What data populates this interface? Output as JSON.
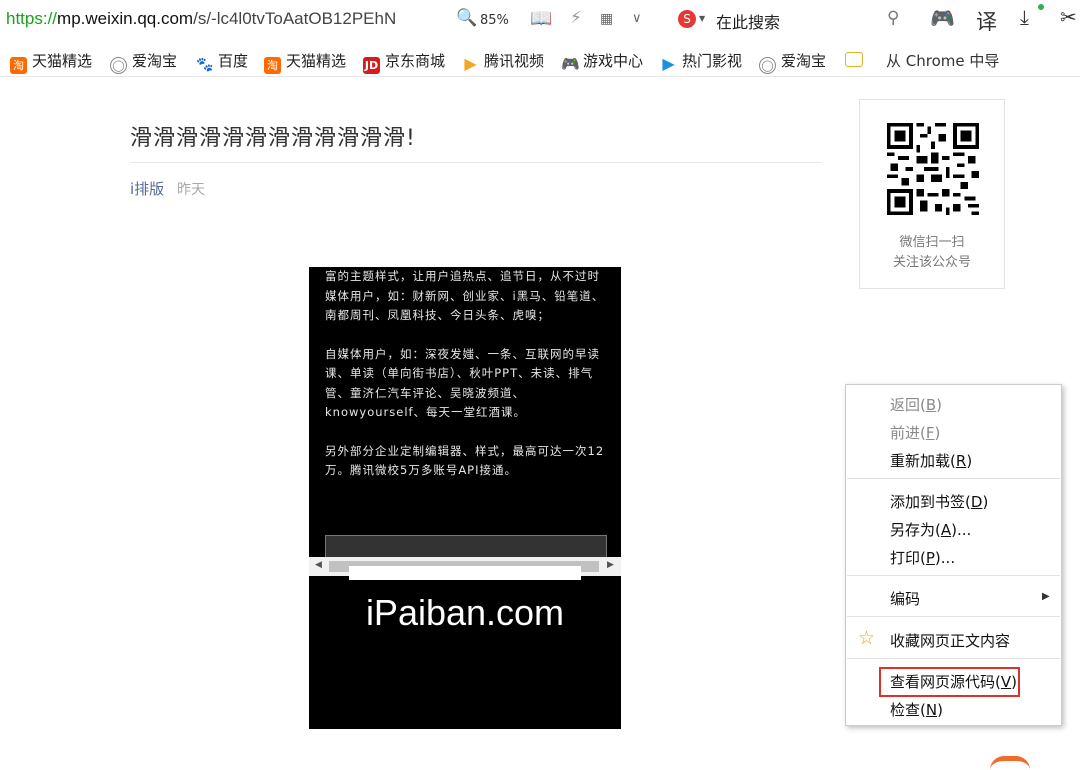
{
  "browser": {
    "url_scheme": "https://",
    "url_host": "mp.weixin.qq.com",
    "url_path": "/s/-lc4l0tvToAatOB12PEhN",
    "zoom": "85%",
    "search_placeholder": "在此搜索",
    "translate_label": "译"
  },
  "bookmarks": [
    {
      "label": "天猫精选",
      "icon": "tmall-icon",
      "color": "#ff6a00"
    },
    {
      "label": "爱淘宝",
      "icon": "globe-icon",
      "color": "#888888"
    },
    {
      "label": "百度",
      "icon": "baidu-paw-icon",
      "color": "#2f5fd6"
    },
    {
      "label": "天猫精选",
      "icon": "tmall-icon",
      "color": "#ff6a00"
    },
    {
      "label": "京东商城",
      "icon": "jd-icon",
      "color": "#d71c1c"
    },
    {
      "label": "腾讯视频",
      "icon": "tencent-video-icon",
      "color": "#f5a623"
    },
    {
      "label": "游戏中心",
      "icon": "gamepad-icon",
      "color": "#2bb24c"
    },
    {
      "label": "热门影视",
      "icon": "play-icon",
      "color": "#1a8fe3"
    },
    {
      "label": "爱淘宝",
      "icon": "globe-icon",
      "color": "#888888"
    },
    {
      "label": "",
      "icon": "folder-icon",
      "color": "#f7c64b"
    },
    {
      "label": "从 Chrome 中导",
      "icon": "",
      "color": ""
    }
  ],
  "article": {
    "title": "滑滑滑滑滑滑滑滑滑滑滑滑!",
    "author": "i排版",
    "date": "昨天",
    "body": [
      "富的主题样式，让用户追热点、追节日，从不过时",
      "媒体用户，如：财新网、创业家、i黑马、铅笔道、南都周刊、凤凰科技、今日头条、虎嗅；",
      "自媒体用户，如：深夜发媸、一条、互联网的早读课、单读（单向街书店）、秋叶PPT、未读、排气管、童济仁汽车评论、吴晓波频道、knowyourself、每天一堂红酒课。",
      "另外部分企业定制编辑器、样式，最高可达一次12万。腾讯微校5万多账号API接通。"
    ],
    "logo_text": "iPaiban.com"
  },
  "qr_card": {
    "line1": "微信扫一扫",
    "line2": "关注该公众号"
  },
  "context_menu": {
    "items": [
      {
        "label": "返回",
        "key": "B",
        "disabled": true
      },
      {
        "label": "前进",
        "key": "F",
        "disabled": true
      },
      {
        "label": "重新加载",
        "key": "R",
        "disabled": false
      },
      {
        "label": "添加到书签",
        "key": "D",
        "disabled": false
      },
      {
        "label": "另存为",
        "key": "A",
        "suffix": "...",
        "disabled": false
      },
      {
        "label": "打印",
        "key": "P",
        "suffix": "...",
        "disabled": false
      },
      {
        "label": "编码",
        "disabled": false,
        "submenu": true
      },
      {
        "label": "收藏网页正文内容",
        "disabled": false,
        "icon": "star-icon"
      },
      {
        "label": "查看网页源代码",
        "key": "V",
        "disabled": false,
        "highlighted": true
      },
      {
        "label": "检查",
        "key": "N",
        "disabled": false
      }
    ]
  }
}
